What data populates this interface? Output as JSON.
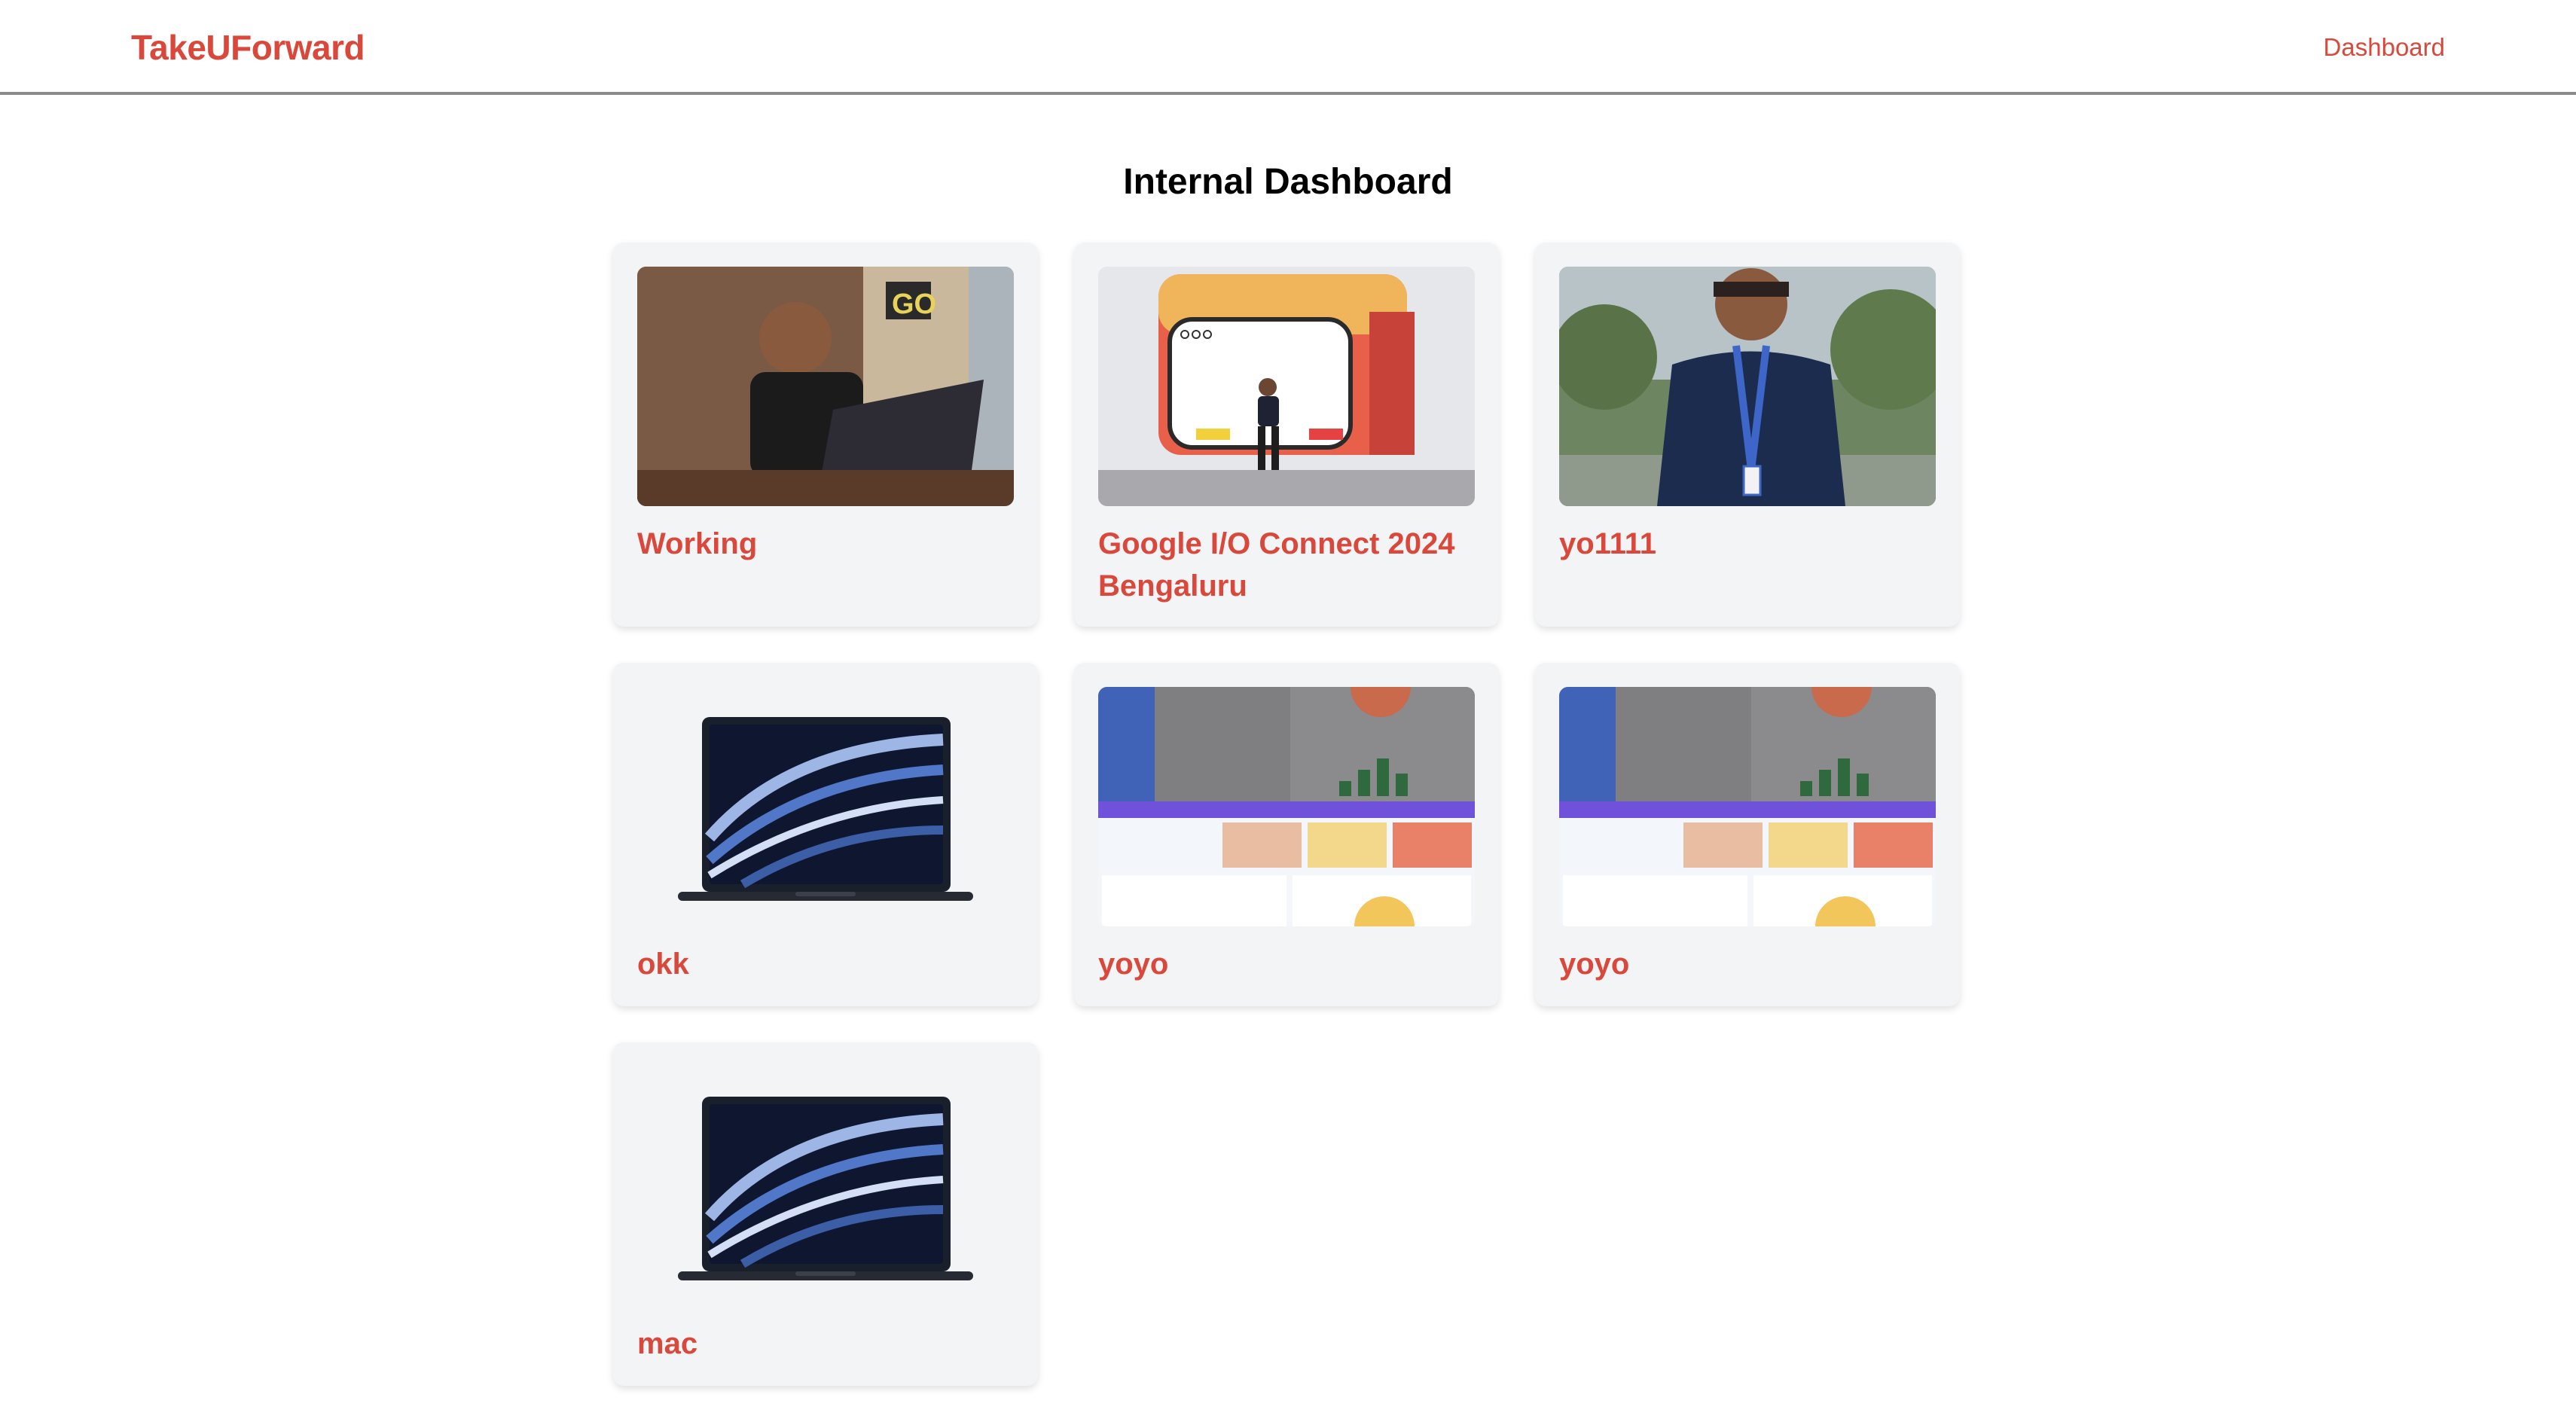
{
  "header": {
    "brand": "TakeUForward",
    "nav_dashboard": "Dashboard"
  },
  "main": {
    "title": "Internal Dashboard"
  },
  "cards": [
    {
      "title": "Working",
      "image": "person-working-laptop-photo"
    },
    {
      "title": "Google I/O Connect 2024 Bengaluru",
      "image": "google-io-photo"
    },
    {
      "title": "yo1111",
      "image": "person-lanyard-photo"
    },
    {
      "title": "okk",
      "image": "macbook-image"
    },
    {
      "title": "yoyo",
      "image": "dashboard-screenshot-image"
    },
    {
      "title": "yoyo",
      "image": "dashboard-screenshot-image"
    },
    {
      "title": "mac",
      "image": "macbook-image"
    }
  ],
  "colors": {
    "accent": "#d9483b",
    "card_bg": "#f3f4f6",
    "navbar_border": "#8a8a8a"
  }
}
